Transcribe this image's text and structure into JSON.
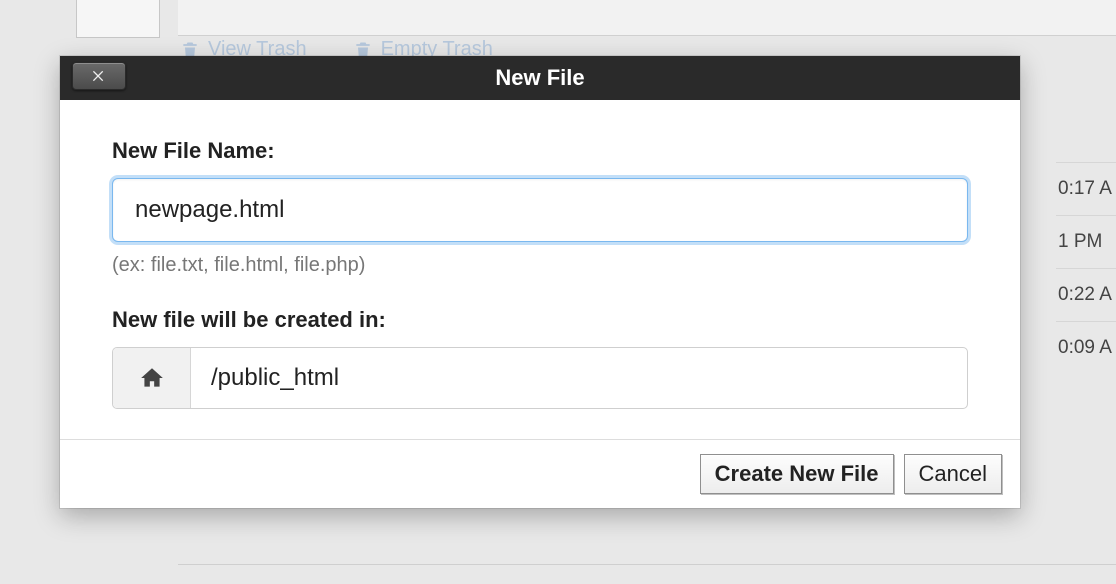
{
  "background": {
    "toolbar": {
      "view_trash": "View Trash",
      "empty_trash": "Empty Trash"
    },
    "time_hints": [
      "0:17 A",
      "1 PM",
      "0:22 A",
      "0:09 A"
    ]
  },
  "modal": {
    "title": "New File",
    "filename": {
      "label": "New File Name:",
      "value": "newpage.html",
      "hint": "(ex: file.txt, file.html, file.php)"
    },
    "location": {
      "label": "New file will be created in:",
      "path": "/public_html"
    },
    "buttons": {
      "create": "Create New File",
      "cancel": "Cancel"
    }
  }
}
